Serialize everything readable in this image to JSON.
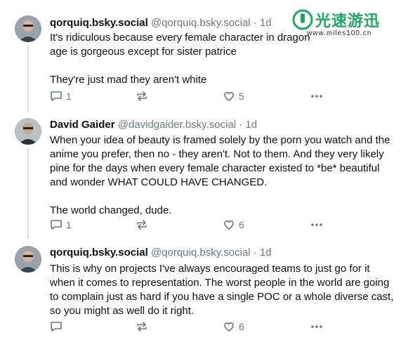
{
  "watermark": {
    "brand": "光速游迅",
    "url": "www.miles100.cn"
  },
  "posts": [
    {
      "name": "qorquiq.bsky.social",
      "handle": "@qorquiq.bsky.social",
      "dot": "·",
      "age": "1d",
      "paragraphs": [
        "It's ridiculous because every female character in dragon age is gorgeous except for sister patrice",
        "They're just mad they aren't white"
      ],
      "replies": "1",
      "likes": "5"
    },
    {
      "name": "David Gaider",
      "handle": "@davidgaider.bsky.social",
      "dot": "·",
      "age": "1d",
      "paragraphs": [
        "When your idea of beauty is framed solely by the porn you watch and the anime you prefer, then no - they aren't. Not to them. And they very likely pine for the days when every female character existed to *be* beautiful and wonder WHAT COULD HAVE CHANGED.",
        "The world changed, dude."
      ],
      "replies": "1",
      "likes": "6"
    },
    {
      "name": "qorquiq.bsky.social",
      "handle": "@qorquiq.bsky.social",
      "dot": "·",
      "age": "1d",
      "paragraphs": [
        "This is why on projects I've always encouraged teams to just go for it when it comes to representation. The worst people in the world are going to complain just as hard if you have a single POC or a whole diverse cast, so you might as well do it right."
      ],
      "replies": "",
      "likes": "6"
    }
  ],
  "icons": {
    "reply": "speech-bubble-icon",
    "repost": "repost-arrows-icon",
    "like": "heart-icon",
    "more": "more-dots-icon"
  },
  "colors": {
    "meta": "#6b7785",
    "thread_line": "#d4dbe2",
    "watermark": "#1aa863"
  }
}
